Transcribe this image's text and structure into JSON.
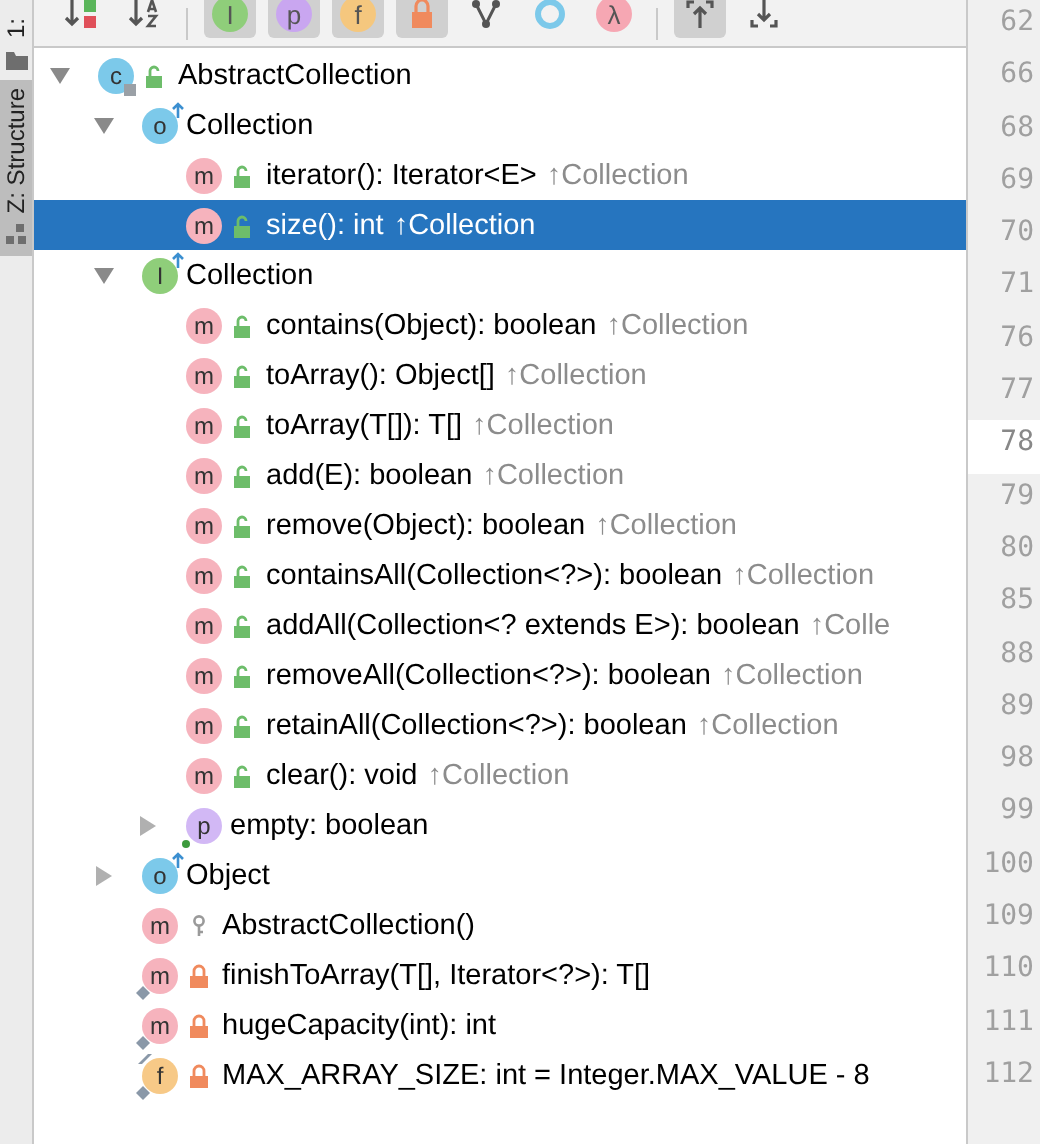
{
  "side_strip": {
    "tabs": [
      {
        "label": "1:",
        "selected": false
      },
      {
        "label": "Z: Structure",
        "selected": true
      }
    ]
  },
  "toolbar": [
    [
      {
        "kind": "sort-visibility",
        "selected": false
      },
      {
        "kind": "sort-alpha",
        "selected": false
      }
    ],
    [
      {
        "kind": "badge",
        "glyph": "I",
        "color": "#8fce7a",
        "selected": true
      },
      {
        "kind": "badge",
        "glyph": "p",
        "color": "#c9a6f0",
        "selected": true
      },
      {
        "kind": "badge",
        "glyph": "f",
        "color": "#f5c77e",
        "selected": true
      },
      {
        "kind": "lock",
        "selected": true
      },
      {
        "kind": "hierarchy",
        "selected": false
      },
      {
        "kind": "ring",
        "selected": false
      },
      {
        "kind": "badge",
        "glyph": "λ",
        "color": "#f6a7b3",
        "selected": false
      }
    ],
    [
      {
        "kind": "scroll-from",
        "selected": true
      },
      {
        "kind": "scroll-to",
        "selected": false
      }
    ]
  ],
  "tree": [
    {
      "kind": "class",
      "badge": "c",
      "access": {
        "kind": "public"
      },
      "label": "AbstractCollection",
      "expanded": true,
      "selected": false,
      "children": [
        {
          "kind": "object",
          "badge": "o",
          "label": "Collection",
          "expanded": true,
          "selected": false,
          "children": [
            {
              "kind": "method",
              "badge": "m",
              "access": {
                "kind": "public"
              },
              "label": "iterator(): Iterator<E>",
              "origin": "↑Collection",
              "selected": false
            },
            {
              "kind": "method",
              "badge": "m",
              "access": {
                "kind": "public"
              },
              "label": "size(): int",
              "origin": "↑Collection",
              "selected": true
            }
          ]
        },
        {
          "kind": "interface",
          "badge": "I",
          "label": "Collection",
          "expanded": true,
          "selected": false,
          "children": [
            {
              "kind": "method",
              "badge": "m",
              "access": {
                "kind": "public"
              },
              "label": "contains(Object): boolean",
              "origin": "↑Collection",
              "selected": false
            },
            {
              "kind": "method",
              "badge": "m",
              "access": {
                "kind": "public"
              },
              "label": "toArray(): Object[]",
              "origin": "↑Collection",
              "selected": false
            },
            {
              "kind": "method",
              "badge": "m",
              "access": {
                "kind": "public"
              },
              "label": "toArray(T[]): T[]",
              "origin": "↑Collection",
              "selected": false
            },
            {
              "kind": "method",
              "badge": "m",
              "access": {
                "kind": "public"
              },
              "label": "add(E): boolean",
              "origin": "↑Collection",
              "selected": false
            },
            {
              "kind": "method",
              "badge": "m",
              "access": {
                "kind": "public"
              },
              "label": "remove(Object): boolean",
              "origin": "↑Collection",
              "selected": false
            },
            {
              "kind": "method",
              "badge": "m",
              "access": {
                "kind": "public"
              },
              "label": "containsAll(Collection<?>): boolean",
              "origin": "↑Collection",
              "selected": false
            },
            {
              "kind": "method",
              "badge": "m",
              "access": {
                "kind": "public"
              },
              "label": "addAll(Collection<? extends E>): boolean",
              "origin": "↑Colle",
              "selected": false
            },
            {
              "kind": "method",
              "badge": "m",
              "access": {
                "kind": "public"
              },
              "label": "removeAll(Collection<?>): boolean",
              "origin": "↑Collection",
              "selected": false
            },
            {
              "kind": "method",
              "badge": "m",
              "access": {
                "kind": "public"
              },
              "label": "retainAll(Collection<?>): boolean",
              "origin": "↑Collection",
              "selected": false
            },
            {
              "kind": "method",
              "badge": "m",
              "access": {
                "kind": "public"
              },
              "label": "clear(): void",
              "origin": "↑Collection",
              "selected": false
            },
            {
              "kind": "property",
              "badge": "p",
              "label": "empty: boolean",
              "expanded": false,
              "accessor": true,
              "selected": false
            }
          ]
        },
        {
          "kind": "object",
          "badge": "o",
          "label": "Object",
          "expanded": false,
          "selected": false
        },
        {
          "kind": "method",
          "badge": "m",
          "access": {
            "kind": "package"
          },
          "label": "AbstractCollection()",
          "selected": false
        },
        {
          "kind": "method",
          "badge": "m",
          "access": {
            "kind": "private"
          },
          "static": true,
          "label": "finishToArray(T[], Iterator<?>): T[]",
          "selected": false
        },
        {
          "kind": "method",
          "badge": "m",
          "access": {
            "kind": "private"
          },
          "static": true,
          "label": "hugeCapacity(int): int",
          "selected": false
        },
        {
          "kind": "field",
          "badge": "f",
          "access": {
            "kind": "private"
          },
          "static": true,
          "final": true,
          "label": "MAX_ARRAY_SIZE: int = Integer.MAX_VALUE - 8",
          "selected": false
        }
      ]
    }
  ],
  "gutter": [
    {
      "number": "62",
      "current": false
    },
    {
      "number": "66",
      "current": false
    },
    {
      "number": "68",
      "current": false
    },
    {
      "number": "69",
      "current": false
    },
    {
      "number": "70",
      "current": false
    },
    {
      "number": "71",
      "current": false
    },
    {
      "number": "76",
      "current": false
    },
    {
      "number": "77",
      "current": false
    },
    {
      "number": "78",
      "current": true
    },
    {
      "number": "79",
      "current": false
    },
    {
      "number": "80",
      "current": false
    },
    {
      "number": "85",
      "current": false
    },
    {
      "number": "88",
      "current": false
    },
    {
      "number": "89",
      "current": false
    },
    {
      "number": "98",
      "current": false
    },
    {
      "number": "99",
      "current": false
    },
    {
      "number": "100",
      "current": false
    },
    {
      "number": "109",
      "current": false
    },
    {
      "number": "110",
      "current": false
    },
    {
      "number": "111",
      "current": false
    },
    {
      "number": "112",
      "current": false
    }
  ]
}
